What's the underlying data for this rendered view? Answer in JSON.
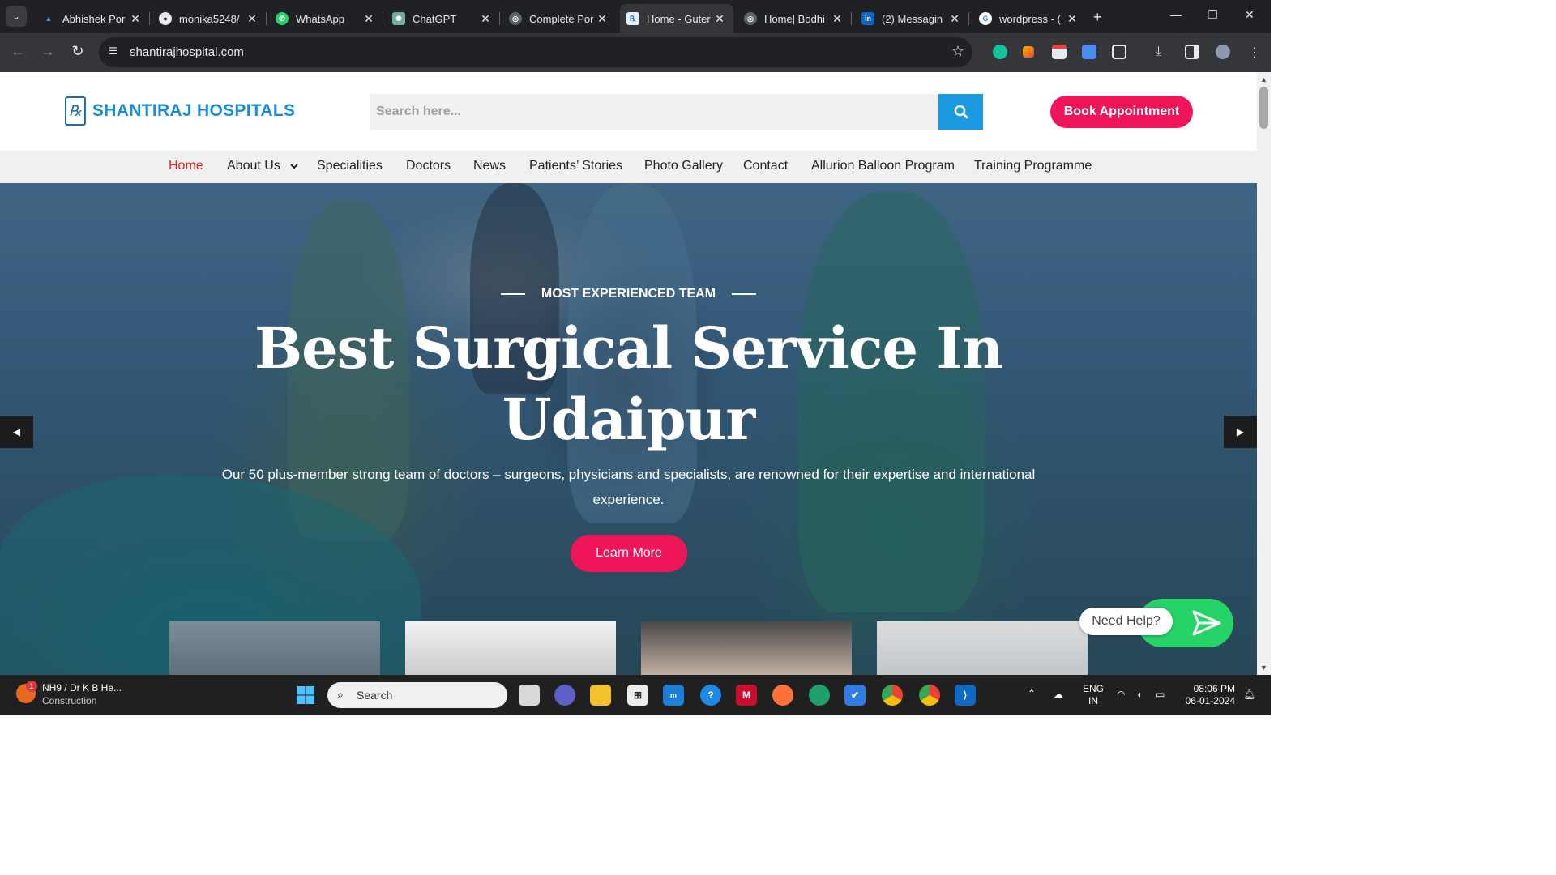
{
  "browser": {
    "tabs": [
      {
        "title": "Abhishek Por",
        "favicon_color": "#1f6fd6",
        "favicon_glyph": "▲",
        "active": false
      },
      {
        "title": "monika5248/",
        "favicon_color": "#2b2b2b",
        "favicon_glyph": "●",
        "active": false
      },
      {
        "title": "WhatsApp",
        "favicon_color": "#25d366",
        "favicon_glyph": "✆",
        "active": false
      },
      {
        "title": "ChatGPT",
        "favicon_color": "#74aa9c",
        "favicon_glyph": "✺",
        "active": false
      },
      {
        "title": "Complete Por",
        "favicon_color": "#5f6368",
        "favicon_glyph": "◎",
        "active": false
      },
      {
        "title": "Home - Guter",
        "favicon_color": "#1a6fb0",
        "favicon_glyph": "℞",
        "active": true
      },
      {
        "title": "Home| Bodhi",
        "favicon_color": "#5f6368",
        "favicon_glyph": "◎",
        "active": false
      },
      {
        "title": "(2) Messagin",
        "favicon_color": "#0a66c2",
        "favicon_glyph": "in",
        "active": false
      },
      {
        "title": "wordpress - (",
        "favicon_color": "#ffffff",
        "favicon_glyph": "G",
        "active": false
      }
    ],
    "url": "shantirajhospital.com"
  },
  "site": {
    "logo_text": "SHANTIRAJ HOSPITALS",
    "logo_mark": "℞",
    "search_placeholder": "Search here...",
    "book_label": "Book Appointment",
    "nav": [
      {
        "label": "Home",
        "active": true
      },
      {
        "label": "About Us",
        "has_dropdown": true
      },
      {
        "label": "Specialities"
      },
      {
        "label": "Doctors"
      },
      {
        "label": "News"
      },
      {
        "label": "Patients’ Stories"
      },
      {
        "label": "Photo Gallery"
      },
      {
        "label": "Contact"
      },
      {
        "label": "Allurion Balloon Program"
      },
      {
        "label": "Training Programme"
      }
    ],
    "hero": {
      "kicker": "MOST EXPERIENCED TEAM",
      "headline_line1": "Best Surgical Service In",
      "headline_line2": "Udaipur",
      "subtext": "Our 50 plus-member strong team of doctors – surgeons, physicians and specialists, are renowned for their expertise and international experience.",
      "cta_label": "Learn More"
    },
    "chat": {
      "label": "Need Help?"
    },
    "colors": {
      "brand_blue": "#1a8cd8",
      "accent_pink": "#ee1559",
      "nav_active": "#e0251f",
      "search_button": "#1a9ae0"
    }
  },
  "taskbar": {
    "weather_title": "NH9 / Dr K B He...",
    "weather_sub": "Construction",
    "weather_badge": "1",
    "search_label": "Search",
    "lang_line1": "ENG",
    "lang_line2": "IN",
    "time": "08:06 PM",
    "date": "06-01-2024"
  }
}
